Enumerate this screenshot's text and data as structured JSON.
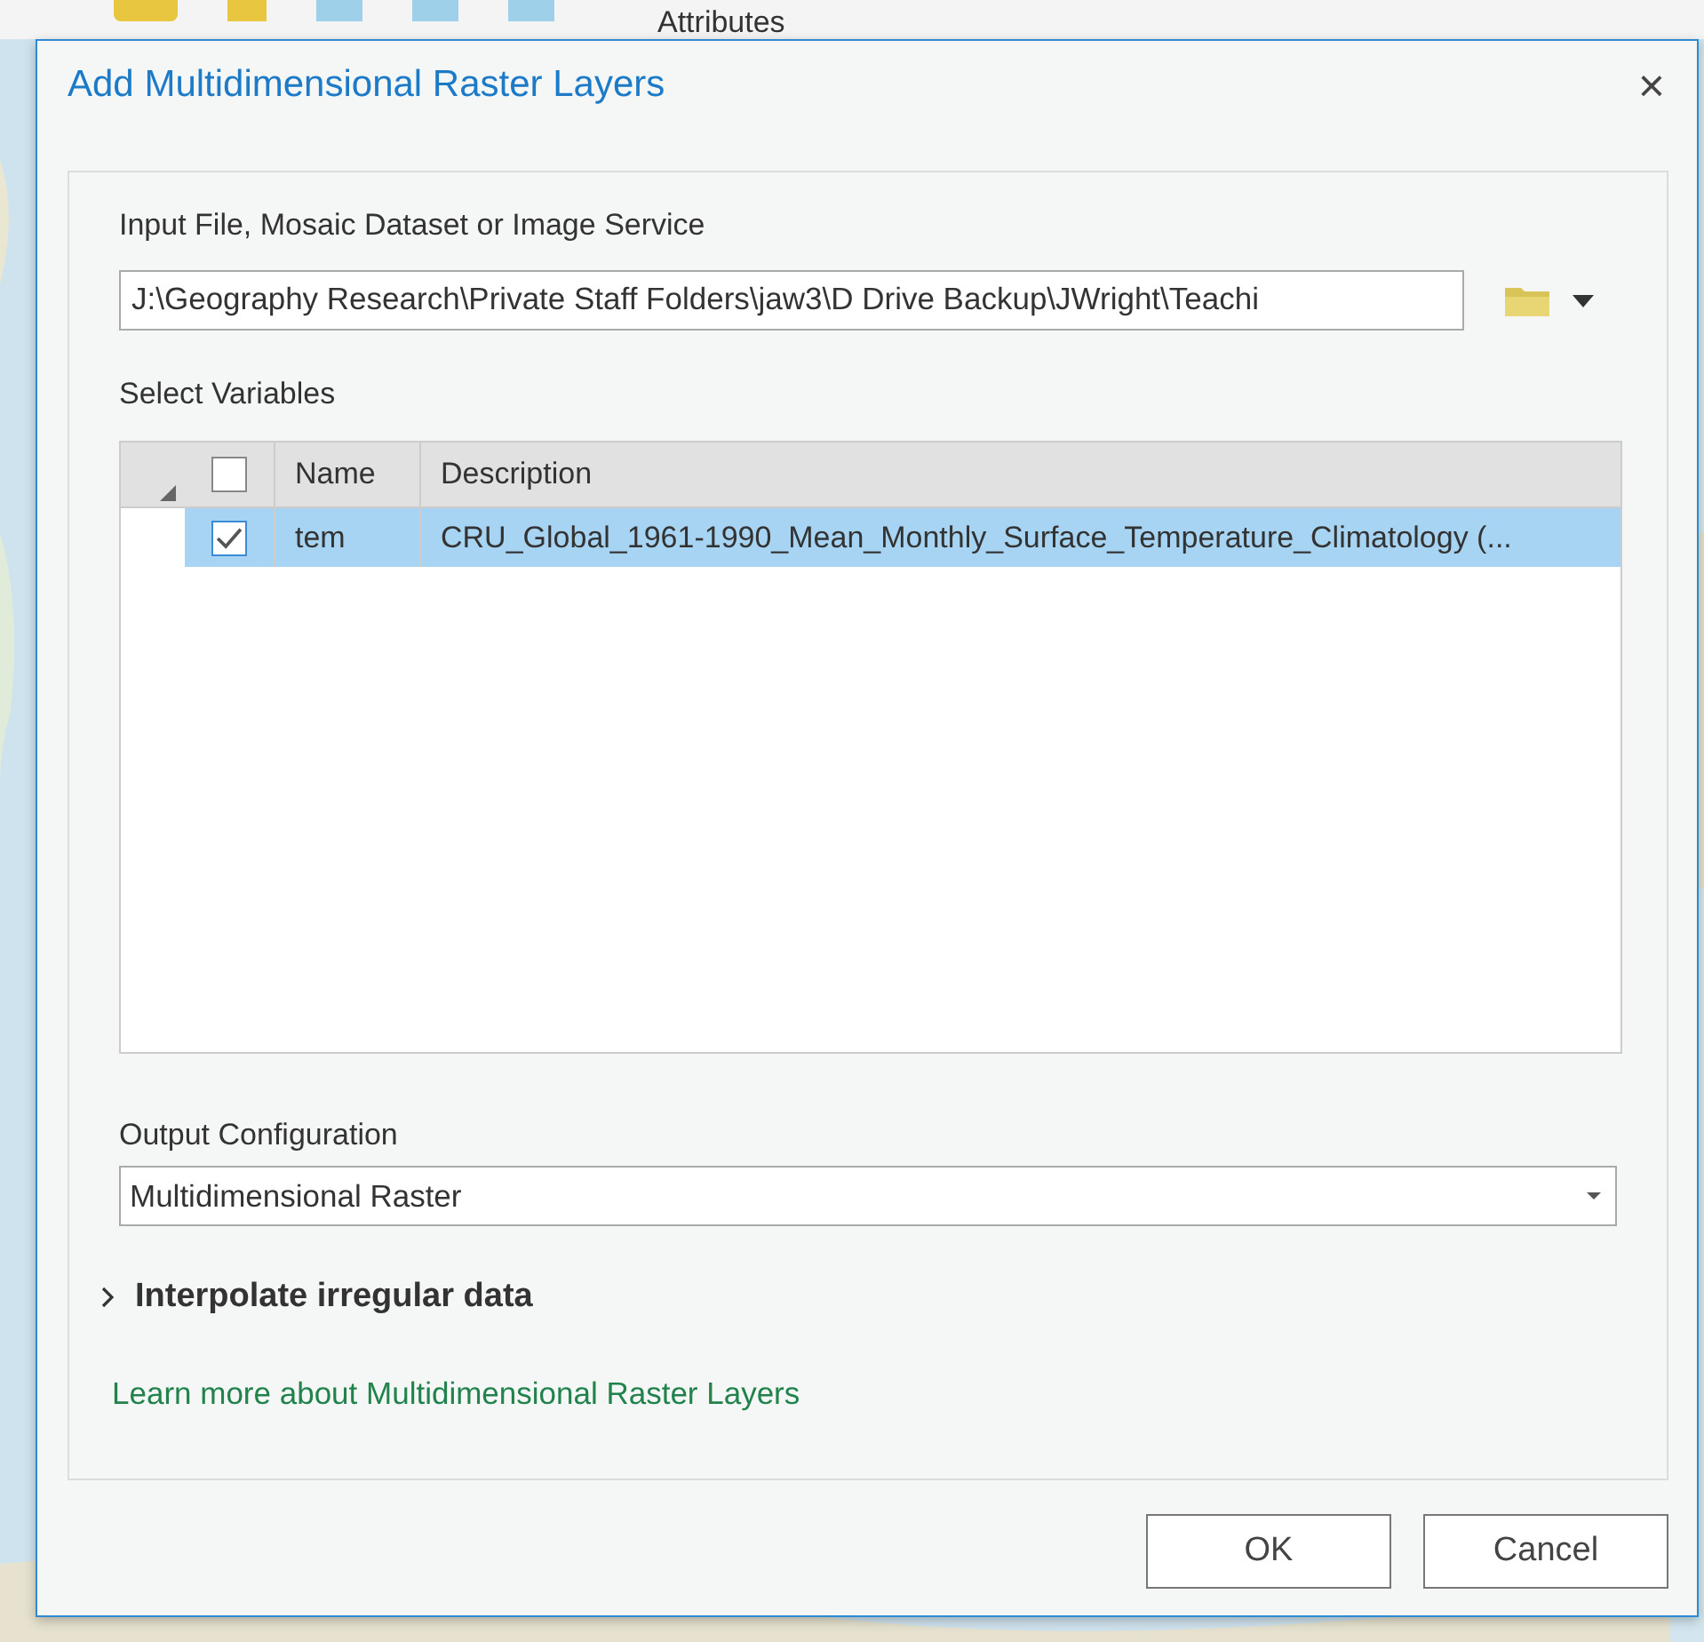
{
  "background_app": {
    "toolbar_label": "Attributes"
  },
  "dialog": {
    "title": "Add Multidimensional Raster Layers",
    "close": "×"
  },
  "input": {
    "label": "Input File, Mosaic Dataset or Image Service",
    "value": "J:\\Geography Research\\Private Staff Folders\\jaw3\\D Drive Backup\\JWright\\Teachi"
  },
  "variables": {
    "label": "Select Variables",
    "select_all_checked": false,
    "columns": [
      "Name",
      "Description"
    ],
    "rows": [
      {
        "name": "tem",
        "description": "CRU_Global_1961-1990_Mean_Monthly_Surface_Temperature_Climatology (...",
        "checked": true,
        "selected": true
      }
    ]
  },
  "output": {
    "label": "Output Configuration",
    "value": "Multidimensional Raster"
  },
  "interpolate": {
    "label": "Interpolate irregular data",
    "expanded": false
  },
  "link": "Learn more about Multidimensional Raster Layers",
  "buttons": [
    "OK",
    "Cancel"
  ]
}
